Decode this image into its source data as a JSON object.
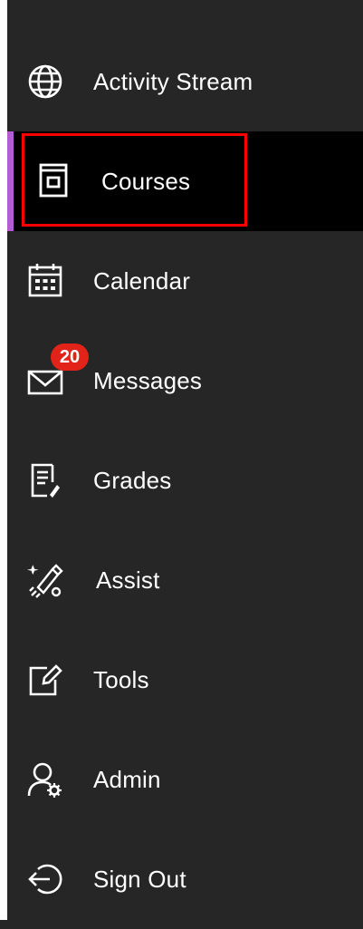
{
  "nav": {
    "items": [
      {
        "label": "Activity Stream",
        "icon": "globe-icon"
      },
      {
        "label": "Courses",
        "icon": "course-icon",
        "active": true
      },
      {
        "label": "Calendar",
        "icon": "calendar-icon"
      },
      {
        "label": "Messages",
        "icon": "envelope-icon",
        "badge": "20"
      },
      {
        "label": "Grades",
        "icon": "grades-icon"
      },
      {
        "label": "Assist",
        "icon": "assist-icon"
      },
      {
        "label": "Tools",
        "icon": "tools-icon"
      },
      {
        "label": "Admin",
        "icon": "admin-icon"
      },
      {
        "label": "Sign Out",
        "icon": "sign-out-icon"
      }
    ]
  },
  "colors": {
    "sidebar_bg": "#262626",
    "active_bg": "#000000",
    "accent": "#b45cd6",
    "badge": "#e2231a",
    "highlight": "#ff0000"
  }
}
